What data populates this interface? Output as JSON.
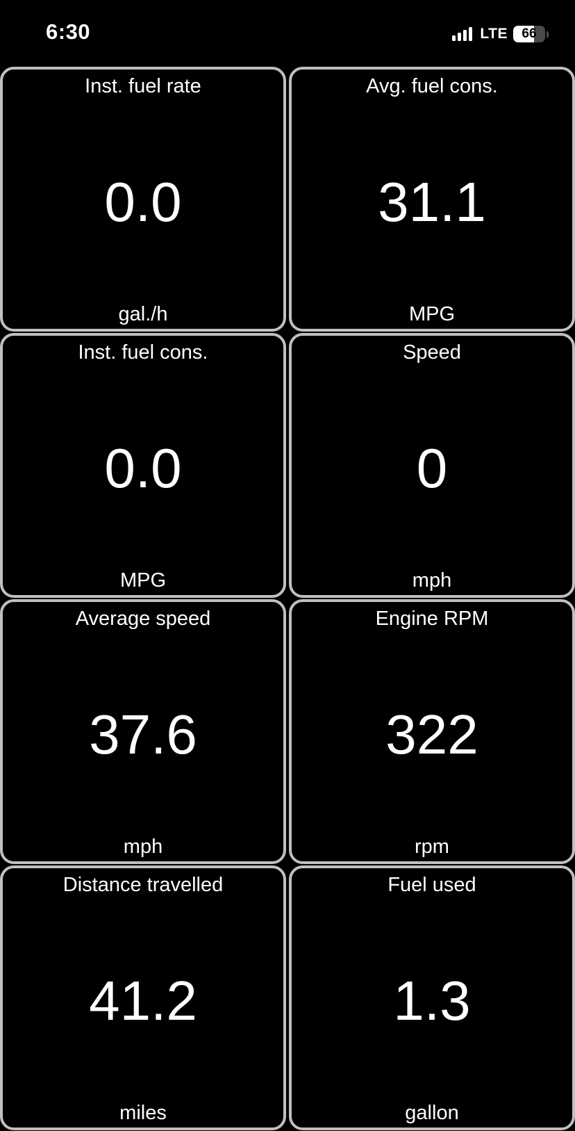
{
  "status_bar": {
    "time": "6:30",
    "network": "LTE",
    "signal_bars": 4,
    "battery_percent": 66,
    "battery_label": "66"
  },
  "gauges": [
    {
      "title": "Inst. fuel rate",
      "value": "0.0",
      "unit": "gal./h"
    },
    {
      "title": "Avg. fuel cons.",
      "value": "31.1",
      "unit": "MPG"
    },
    {
      "title": "Inst. fuel cons.",
      "value": "0.0",
      "unit": "MPG"
    },
    {
      "title": "Speed",
      "value": "0",
      "unit": "mph"
    },
    {
      "title": "Average speed",
      "value": "37.6",
      "unit": "mph"
    },
    {
      "title": "Engine RPM",
      "value": "322",
      "unit": "rpm"
    },
    {
      "title": "Distance travelled",
      "value": "41.2",
      "unit": "miles"
    },
    {
      "title": "Fuel used",
      "value": "1.3",
      "unit": "gallon"
    }
  ],
  "colors": {
    "background": "#000000",
    "tile_border": "#c0c0c0",
    "text": "#ffffff"
  }
}
